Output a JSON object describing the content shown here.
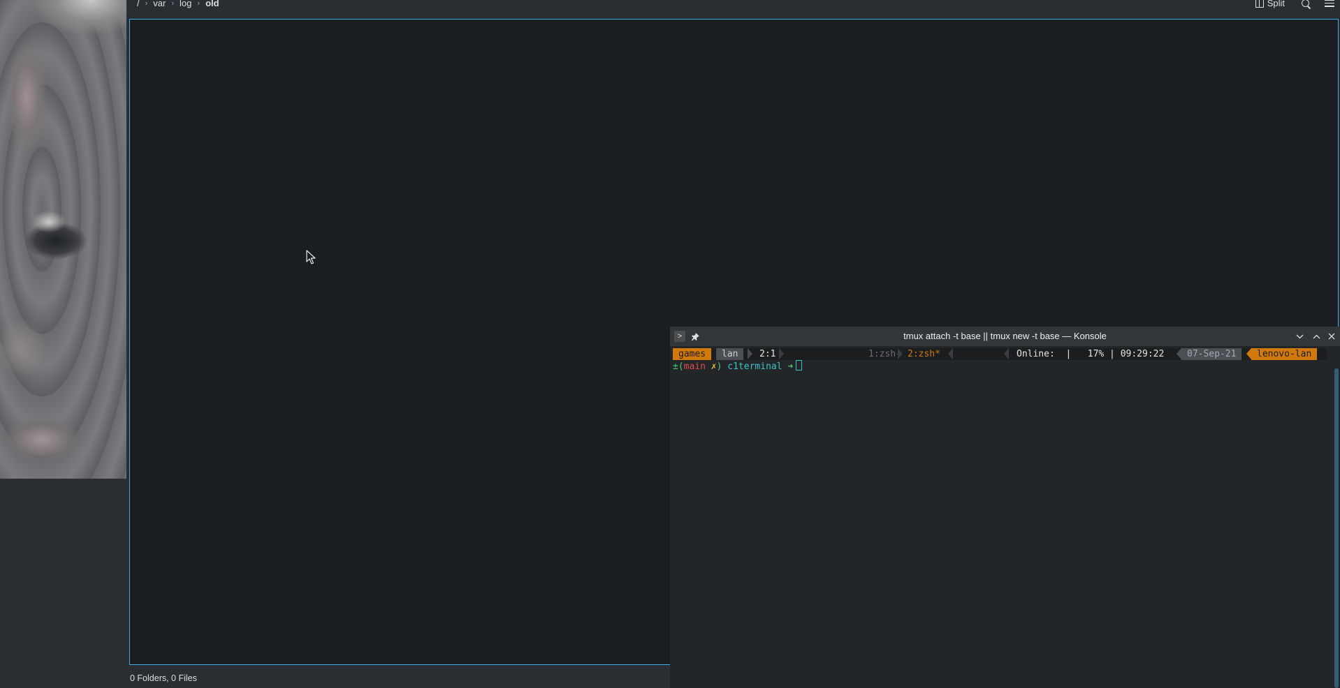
{
  "file_manager": {
    "breadcrumb": [
      {
        "label": "/"
      },
      {
        "label": "var"
      },
      {
        "label": "log"
      },
      {
        "label": "old"
      }
    ],
    "toolbar": {
      "split_label": "Split",
      "split_icon": "split-view-icon",
      "search_icon": "search-icon",
      "menu_icon": "hamburger-menu-icon"
    },
    "status_text": "0 Folders, 0 Files",
    "accent_color": "#3daee9"
  },
  "konsole": {
    "title": "tmux attach -t base || tmux new -t base — Konsole",
    "tmux_status": {
      "session": "games",
      "host": "lan",
      "pane": "2:1",
      "window_1": "1:zsh-",
      "window_2": "2:zsh*",
      "online": "Online:  |   17% | 09:29:22",
      "date": "07-Sep-21",
      "machine": "lenovo-lan"
    },
    "prompt": {
      "git_prefix": "±(",
      "branch": "main",
      "dirty_mark": "✗",
      "close_paren": ")",
      "directory": "c1terminal",
      "arrow": "➜"
    },
    "accent_color": "#d2790b"
  }
}
